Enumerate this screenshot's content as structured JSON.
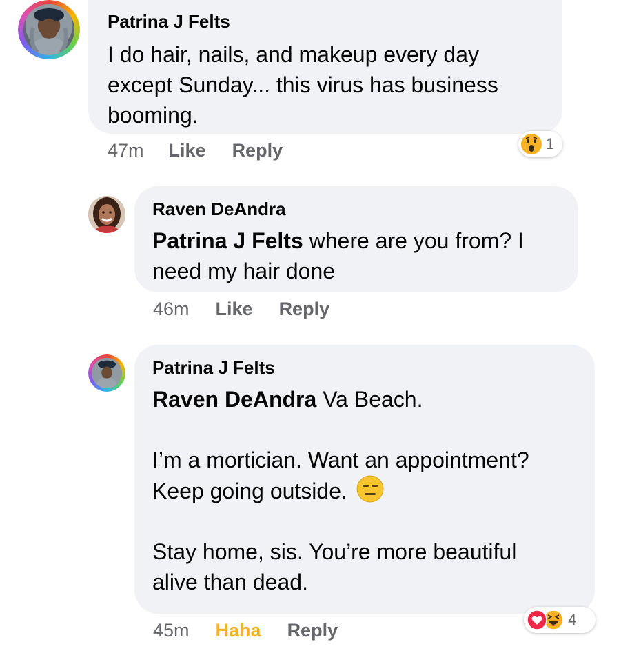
{
  "comments": [
    {
      "author": "Patrina J Felts",
      "lines": [
        "I do hair, nails, and makeup every day",
        "except Sunday... this virus has business",
        "booming."
      ],
      "time": "47m",
      "like": "Like",
      "reply": "Reply",
      "reaction_count": "1",
      "reaction_icons": [
        "wow-icon"
      ]
    },
    {
      "author": "Raven DeAndra",
      "mention": "Patrina J Felts",
      "line1_rest": " where are you from? I",
      "line2": "need my hair done",
      "time": "46m",
      "like": "Like",
      "reply": "Reply"
    },
    {
      "author": "Patrina J Felts",
      "mention": "Raven DeAndra",
      "line1_rest": " Va Beach.",
      "line2": "I’m a mortician. Want an appointment?",
      "line3": "Keep going outside.",
      "line4": "Stay home, sis. You’re more beautiful",
      "line5": "alive than dead.",
      "time": "45m",
      "like": "Haha",
      "reply": "Reply",
      "reaction_count": "4",
      "reaction_icons": [
        "love-icon",
        "haha-icon"
      ],
      "inline_emoji": "expressionless-face-icon",
      "like_color": "#f7b125"
    }
  ]
}
